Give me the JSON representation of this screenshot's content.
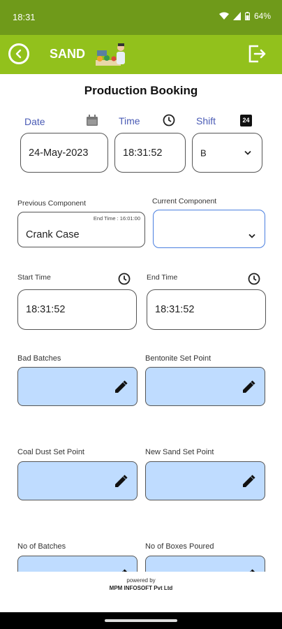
{
  "status": {
    "time": "18:31",
    "battery": "64%"
  },
  "appbar": {
    "title": "SAND"
  },
  "page_title": "Production Booking",
  "top_fields": {
    "date": {
      "label": "Date",
      "value": "24-May-2023"
    },
    "time": {
      "label": "Time",
      "value": "18:31:52"
    },
    "shift": {
      "label": "Shift",
      "value": "B",
      "icon_text": "24"
    }
  },
  "components": {
    "previous": {
      "label": "Previous Component",
      "value": "Crank Case",
      "end_time": "End Time : 16:01:00"
    },
    "current": {
      "label": "Current Component",
      "value": ""
    }
  },
  "times": {
    "start": {
      "label": "Start Time",
      "value": "18:31:52"
    },
    "end": {
      "label": "End Time",
      "value": "18:31:52"
    }
  },
  "edit_fields": {
    "bad_batches": {
      "label": "Bad Batches",
      "value": ""
    },
    "bentonite": {
      "label": "Bentonite Set Point",
      "value": ""
    },
    "coal_dust": {
      "label": "Coal Dust Set Point",
      "value": ""
    },
    "new_sand": {
      "label": "New Sand Set Point",
      "value": ""
    },
    "no_batches": {
      "label": "No of Batches",
      "value": ""
    },
    "no_boxes": {
      "label": "No of Boxes Poured",
      "value": ""
    }
  },
  "footer": {
    "powered_by": "powered by",
    "company": "MPM INFOSOFT Pvt Ltd"
  },
  "colors": {
    "status_bar": "#6f9a1a",
    "app_bar": "#92c11c",
    "label_blue": "#4a5bb5",
    "field_fill": "#bfdcff",
    "focus_border": "#4a7fe0"
  }
}
